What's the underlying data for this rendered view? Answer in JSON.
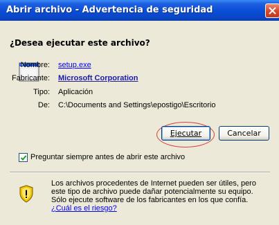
{
  "window": {
    "title": "Abrir archivo - Advertencia de seguridad"
  },
  "dialog": {
    "question": "¿Desea ejecutar este archivo?",
    "file_info": [
      {
        "label": "Nombre:",
        "value": "setup.exe",
        "style": "link"
      },
      {
        "label": "Fabricante:",
        "value": "Microsoft Corporation",
        "style": "bold-link"
      },
      {
        "label": "Tipo:",
        "value": "Aplicación",
        "style": "text"
      },
      {
        "label": "De:",
        "value": "C:\\Documents and Settings\\epostigo\\Escritorio",
        "style": "text"
      }
    ],
    "buttons": {
      "run": "Ejecutar",
      "cancel": "Cancelar"
    },
    "checkbox": {
      "label": "Preguntar siempre antes de abrir este archivo",
      "checked": true
    },
    "warning": {
      "text": "Los archivos procedentes de Internet pueden ser útiles, pero este tipo de archivo puede dañar potencialmente su equipo. Sólo ejecute software de los fabricantes en los que confía.",
      "link": "¿Cuál es el riesgo?"
    }
  },
  "colors": {
    "titlebar": "#0a4fd8",
    "link": "#0000ff",
    "annotation": "#d44040"
  }
}
